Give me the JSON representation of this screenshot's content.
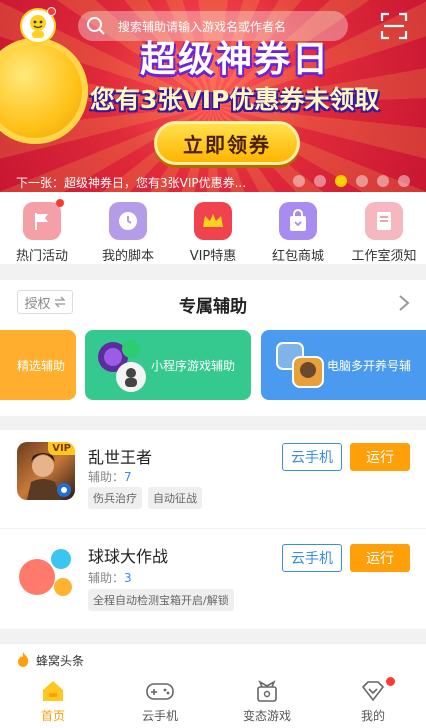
{
  "search": {
    "placeholder": "搜索辅助请输入游戏名或作者名"
  },
  "banner": {
    "title": "超级神券日",
    "subtitle": "您有3张VIP优惠券未领取",
    "button_label": "立即领券",
    "caption": "下一张：超级神券日，您有3张VIP优惠券...",
    "slide_count": 6,
    "active_slide": 3
  },
  "quick_menu": [
    {
      "label": "热门活动",
      "icon": "flag-icon",
      "color": "#f5a0a8"
    },
    {
      "label": "我的脚本",
      "icon": "clock-icon",
      "color": "#b59ce8"
    },
    {
      "label": "VIP特惠",
      "icon": "crown-icon",
      "color": "#f0434e"
    },
    {
      "label": "红包商城",
      "icon": "shopping-bag-icon",
      "color": "#a88cf0"
    },
    {
      "label": "工作室须知",
      "icon": "book-icon",
      "color": "#f5b8c0"
    }
  ],
  "exclusive": {
    "auth_label": "授权",
    "title": "专属辅助",
    "cards": [
      {
        "label": "精选辅助",
        "color": "#ffae2e"
      },
      {
        "label": "小程序游戏辅助",
        "color": "#35c98f"
      },
      {
        "label": "电脑多开养号辅",
        "color": "#4a9bf0"
      }
    ]
  },
  "games": [
    {
      "name": "乱世王者",
      "helper_label": "辅助：",
      "helper_count": "7",
      "tags": [
        "伤兵治疗",
        "自动征战"
      ],
      "vip_label": "VIP",
      "cloud_label": "云手机",
      "run_label": "运行"
    },
    {
      "name": "球球大作战",
      "helper_label": "辅助：",
      "helper_count": "3",
      "tags": [
        "全程自动检测宝箱开启/解锁"
      ],
      "cloud_label": "云手机",
      "run_label": "运行"
    }
  ],
  "headline": {
    "label": "蜂窝头条"
  },
  "tabs": [
    {
      "label": "首页",
      "icon": "home-icon",
      "active": true
    },
    {
      "label": "云手机",
      "icon": "gamepad-icon",
      "active": false
    },
    {
      "label": "变态游戏",
      "icon": "gift-box-icon",
      "active": false
    },
    {
      "label": "我的",
      "icon": "profile-icon",
      "active": false
    }
  ],
  "colors": {
    "accent": "#ff9f0a",
    "link": "#3b8be8",
    "badge": "#ff3b30"
  }
}
